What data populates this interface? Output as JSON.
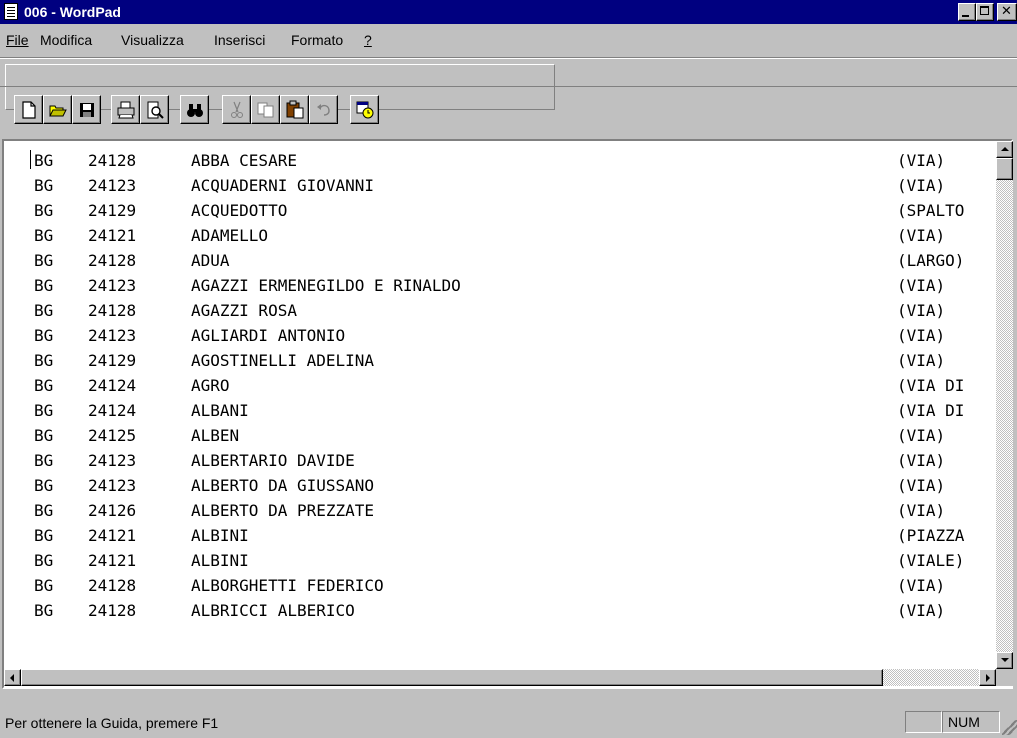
{
  "window": {
    "title": "006 - WordPad"
  },
  "menu": [
    {
      "label": "File"
    },
    {
      "label": "Modifica"
    },
    {
      "label": "Visualizza"
    },
    {
      "label": "Inserisci"
    },
    {
      "label": "Formato"
    },
    {
      "label": "?"
    }
  ],
  "toolbar": {
    "buttons": [
      "new-icon",
      "open-icon",
      "save-icon",
      "print-icon",
      "print-preview-icon",
      "find-icon",
      "cut-icon",
      "copy-icon",
      "paste-icon",
      "undo-icon",
      "date-time-icon"
    ]
  },
  "document": {
    "rows": [
      {
        "prov": "BG",
        "cap": "24128",
        "name": "ABBA CESARE",
        "type": "(VIA)"
      },
      {
        "prov": "BG",
        "cap": "24123",
        "name": "ACQUADERNI GIOVANNI",
        "type": "(VIA)"
      },
      {
        "prov": "BG",
        "cap": "24129",
        "name": "ACQUEDOTTO",
        "type": "(SPALTO"
      },
      {
        "prov": "BG",
        "cap": "24121",
        "name": "ADAMELLO",
        "type": "(VIA)"
      },
      {
        "prov": "BG",
        "cap": "24128",
        "name": "ADUA",
        "type": "(LARGO)"
      },
      {
        "prov": "BG",
        "cap": "24123",
        "name": "AGAZZI ERMENEGILDO E RINALDO",
        "type": "(VIA)"
      },
      {
        "prov": "BG",
        "cap": "24128",
        "name": "AGAZZI ROSA",
        "type": "(VIA)"
      },
      {
        "prov": "BG",
        "cap": "24123",
        "name": "AGLIARDI ANTONIO",
        "type": "(VIA)"
      },
      {
        "prov": "BG",
        "cap": "24129",
        "name": "AGOSTINELLI ADELINA",
        "type": "(VIA)"
      },
      {
        "prov": "BG",
        "cap": "24124",
        "name": "AGRO",
        "type": "(VIA DI"
      },
      {
        "prov": "BG",
        "cap": "24124",
        "name": "ALBANI",
        "type": "(VIA DI"
      },
      {
        "prov": "BG",
        "cap": "24125",
        "name": "ALBEN",
        "type": "(VIA)"
      },
      {
        "prov": "BG",
        "cap": "24123",
        "name": "ALBERTARIO DAVIDE",
        "type": "(VIA)"
      },
      {
        "prov": "BG",
        "cap": "24123",
        "name": "ALBERTO DA GIUSSANO",
        "type": "(VIA)"
      },
      {
        "prov": "BG",
        "cap": "24126",
        "name": "ALBERTO DA PREZZATE",
        "type": "(VIA)"
      },
      {
        "prov": "BG",
        "cap": "24121",
        "name": "ALBINI",
        "type": "(PIAZZA"
      },
      {
        "prov": "BG",
        "cap": "24121",
        "name": "ALBINI",
        "type": "(VIALE)"
      },
      {
        "prov": "BG",
        "cap": "24128",
        "name": "ALBORGHETTI FEDERICO",
        "type": "(VIA)"
      },
      {
        "prov": "BG",
        "cap": "24128",
        "name": "ALBRICCI ALBERICO",
        "type": "(VIA)"
      }
    ]
  },
  "status": {
    "help_text": "Per ottenere la Guida, premere F1",
    "num_indicator": "NUM"
  }
}
